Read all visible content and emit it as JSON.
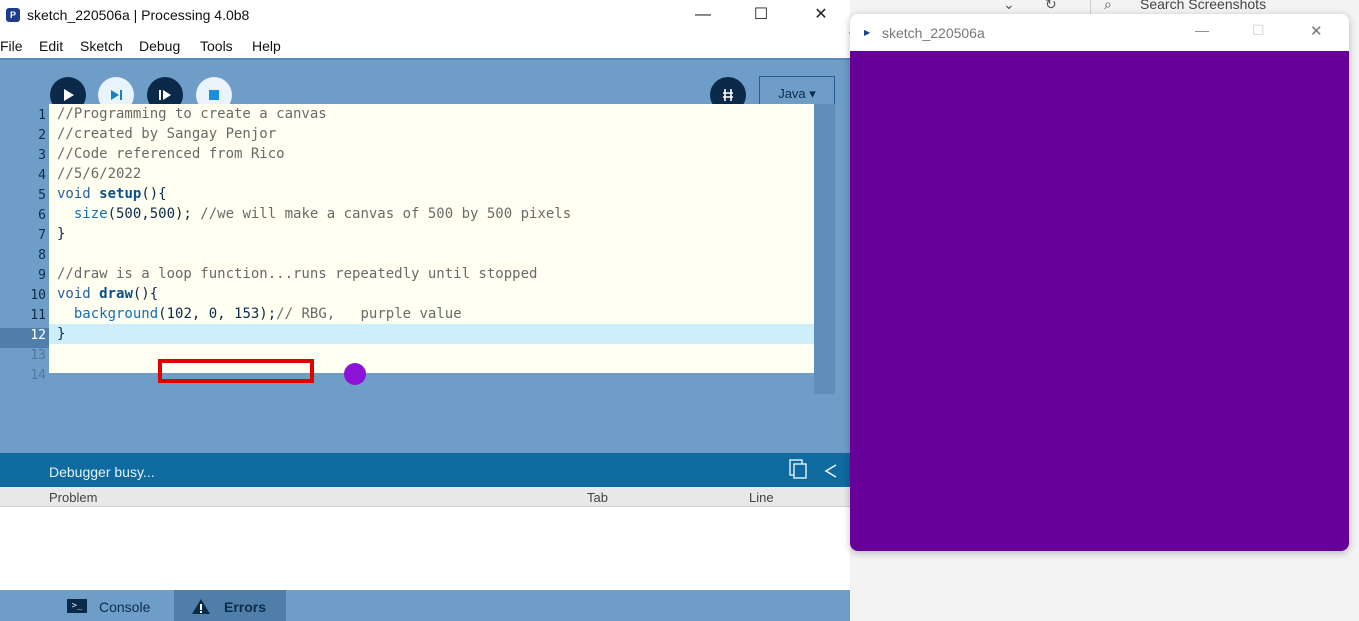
{
  "background": {
    "search_placeholder": "Search Screenshots"
  },
  "ide": {
    "title": "sketch_220506a | Processing 4.0b8",
    "menu": [
      "File",
      "Edit",
      "Sketch",
      "Debug",
      "Tools",
      "Help"
    ],
    "mode": "Java ▾",
    "tab_name": "sketch_220506a",
    "line_numbers": [
      "1",
      "2",
      "3",
      "4",
      "5",
      "6",
      "7",
      "8",
      "9",
      "10",
      "11",
      "12",
      "13",
      "14"
    ],
    "code": {
      "l1": "//Programming to create a canvas",
      "l2": "//created by Sangay Penjor",
      "l3": "//Code referenced from Rico",
      "l4": "//5/6/2022",
      "l5_kw": "void",
      "l5_fn": "setup",
      "l5_rest": "(){",
      "l6_call": "size",
      "l6_args": "(500,500); ",
      "l6_cm": "//we will make a canvas of 500 by 500 pixels",
      "l7": "}",
      "l9": "//draw is a loop function...runs repeatedly until stopped",
      "l10_kw": "void",
      "l10_fn": "draw",
      "l10_rest": "(){",
      "l11_call": "background",
      "l11_args": "(102, 0, 153);",
      "l11_cm": "// RBG,",
      "l11_cm2": "purple value",
      "l12": "}"
    },
    "status": "Debugger busy...",
    "problems_columns": [
      "Problem",
      "Tab",
      "Line"
    ],
    "bottom_tabs": {
      "console": "Console",
      "errors": "Errors"
    }
  },
  "sketch_window": {
    "title": "sketch_220506a",
    "canvas_color": "#660099"
  },
  "colors": {
    "toolbar": "#6e9ec7",
    "editor_bg": "#fffff2",
    "status_bar": "#0f6aa0",
    "highlight": "#e00000",
    "swatch": "#8a13d6"
  }
}
